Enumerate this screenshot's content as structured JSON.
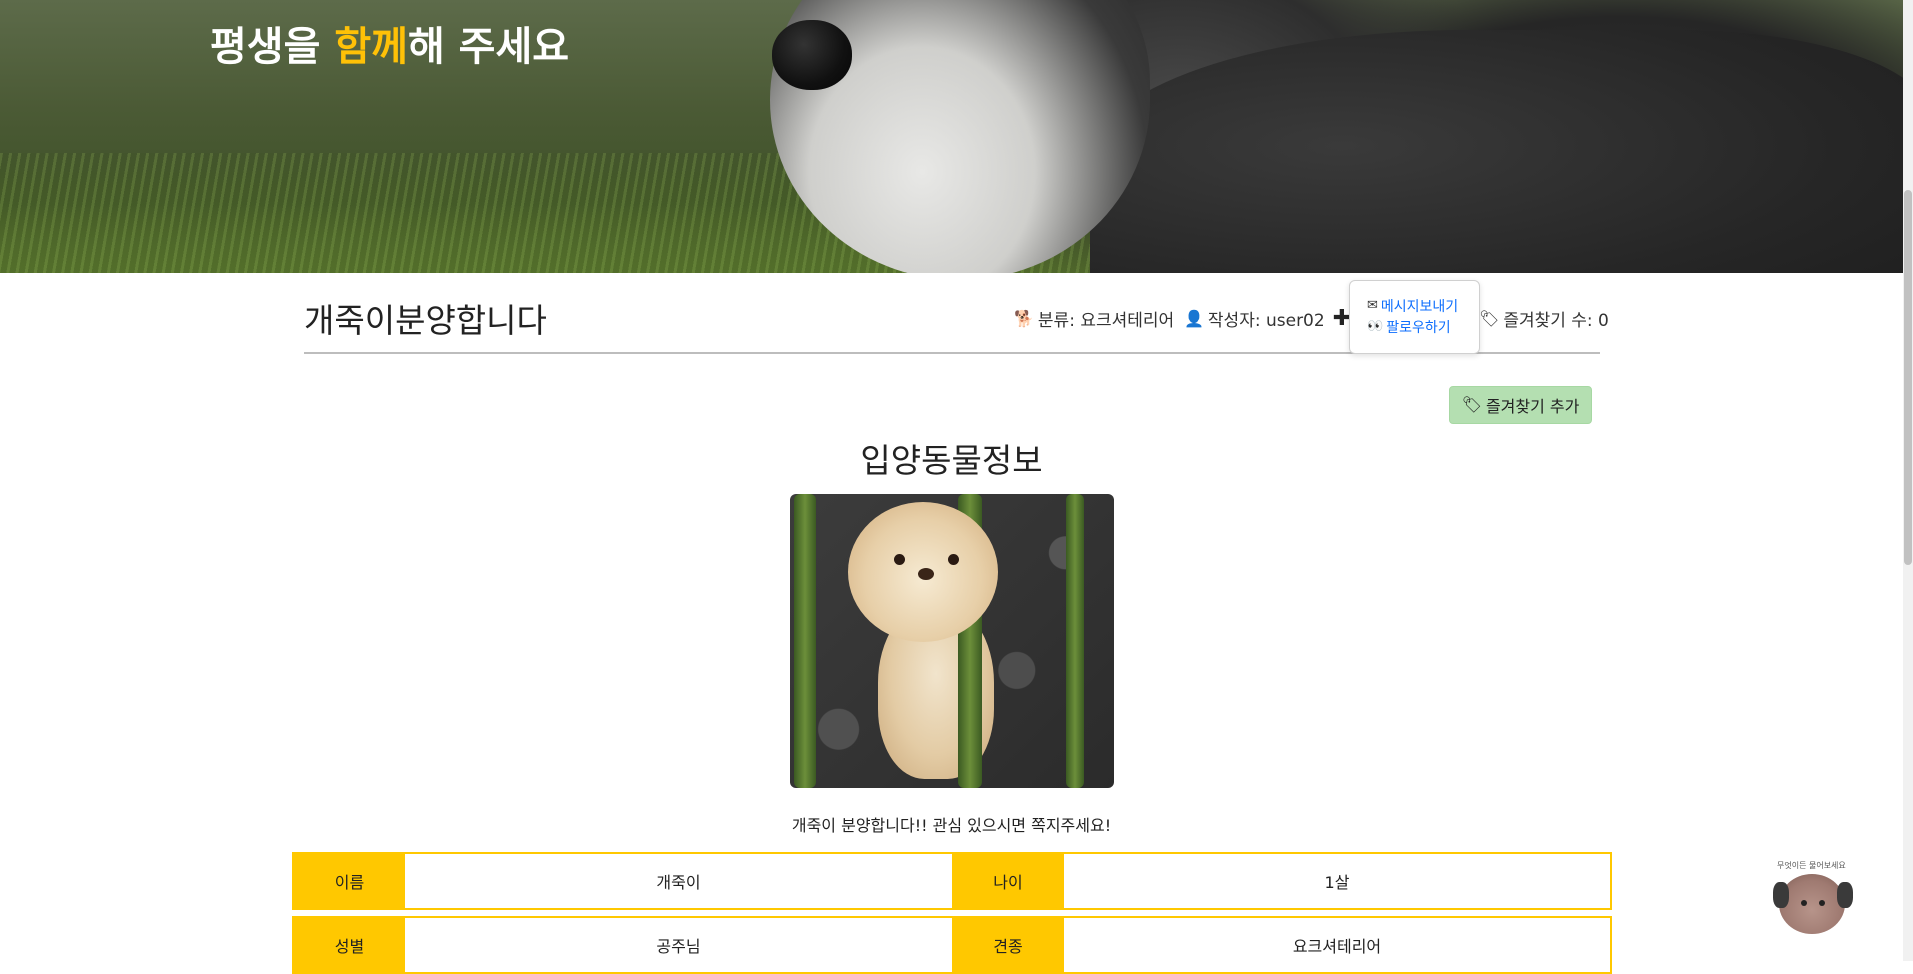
{
  "hero": {
    "line1_visible_part": "",
    "line2_part1": "평생을 ",
    "line2_highlight": "함께",
    "line2_part2": "해 주세요"
  },
  "post": {
    "title": "개죽이분양합니다",
    "category_label": "분류: 요크셔테리어",
    "author_label": "작성자: user02",
    "favorites_label": "즐겨찾기 수: 0"
  },
  "popover": {
    "send_message": "메시지보내기",
    "follow": "팔로우하기"
  },
  "actions": {
    "add_favorite": "즐겨찾기 추가"
  },
  "section": {
    "title": "입양동물정보",
    "caption": "개죽이 분양합니다!! 관심 있으시면 쪽지주세요!"
  },
  "info_table": {
    "rows": [
      {
        "label1": "이름",
        "value1": "개죽이",
        "label2": "나이",
        "value2": "1살"
      },
      {
        "label1": "성별",
        "value1": "공주님",
        "label2": "견종",
        "value2": "요크셔테리어"
      }
    ]
  },
  "widget": {
    "text": "무엇이든 물어보세요"
  },
  "icons": {
    "category": "dog-icon",
    "author": "person-icon",
    "follow_plus": "plus-icon",
    "message": "envelope-icon",
    "follow_eyes": "eyes-icon",
    "bookmark": "bookmark-icon"
  },
  "colors": {
    "accent_yellow": "#ffc800",
    "highlight_yellow": "#ffc107",
    "link_blue": "#0d6efd",
    "success_green": "#b4dfb1"
  }
}
